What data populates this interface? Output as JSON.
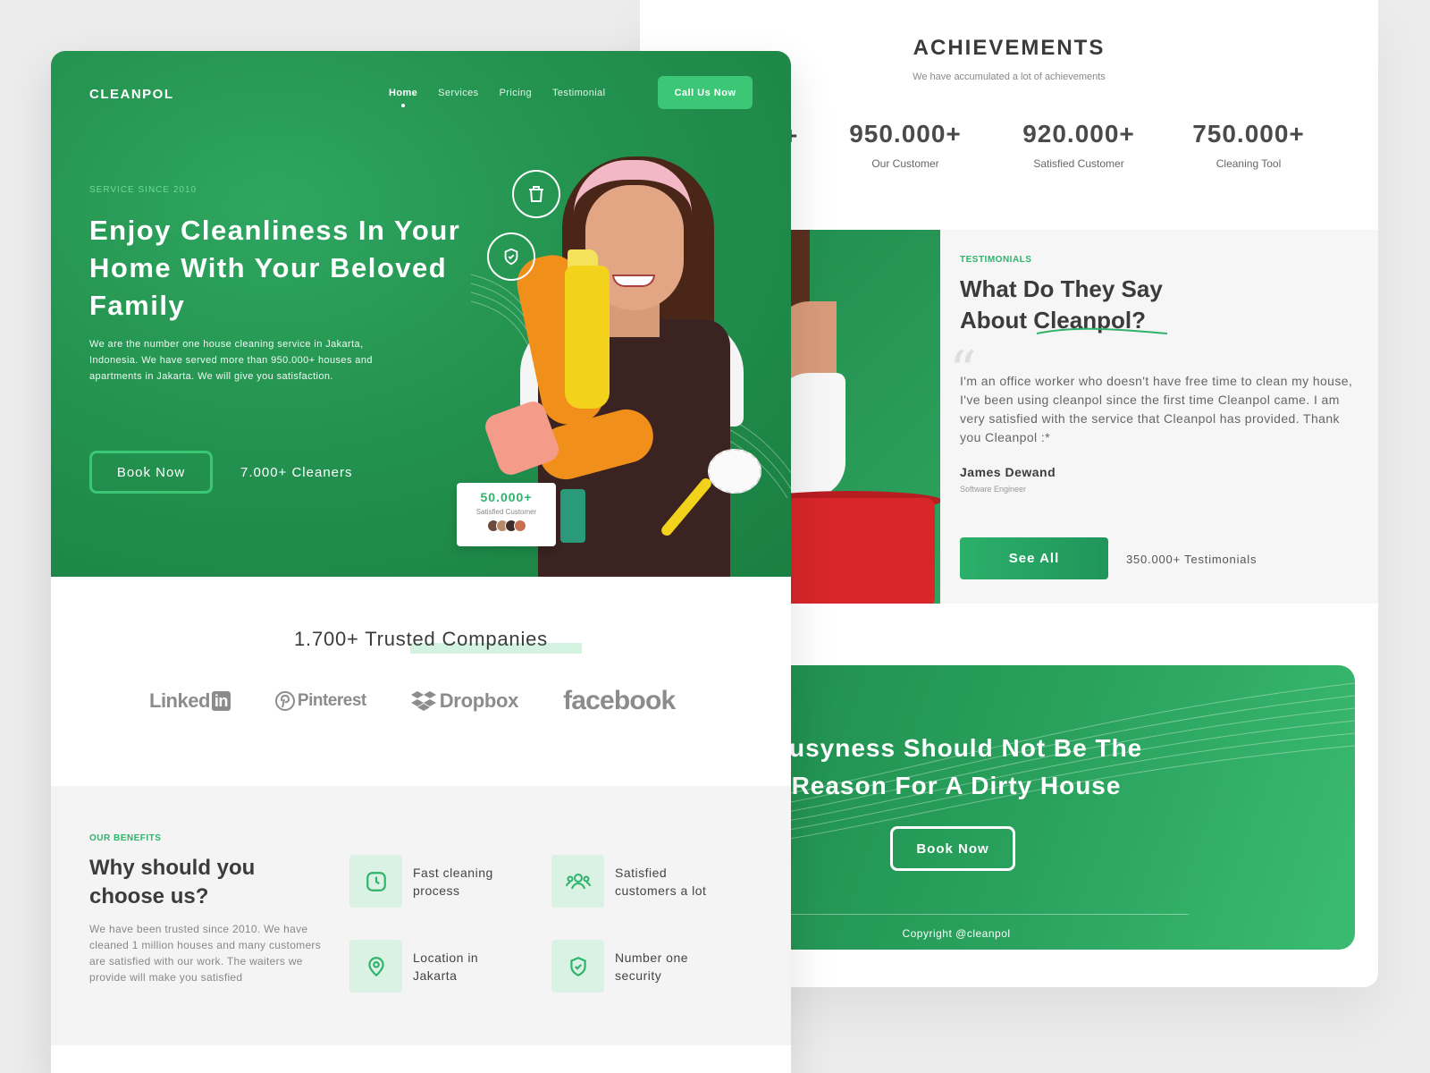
{
  "achievements": {
    "title": "ACHIEVEMENTS",
    "subtitle": "We have accumulated a lot of achievements",
    "stats": [
      {
        "value": "950.000+",
        "label": "Our Customer"
      },
      {
        "value": "920.000+",
        "label": "Satisfied Customer"
      },
      {
        "value": "750.000+",
        "label": "Cleaning Tool"
      }
    ]
  },
  "testimonials": {
    "eyebrow": "TESTIMONIALS",
    "heading_line1": "What Do They Say",
    "heading_line2": "About Cleanpol?",
    "quote": "I'm an office worker who doesn't have free time to clean my house, I've been using cleanpol since the first time Cleanpol came. I am very satisfied with the service that Cleanpol has provided. Thank you Cleanpol :*",
    "author": "James Dewand",
    "role": "Software Engineer",
    "see_all_label": "See All",
    "count": "350.000+ Testimonials"
  },
  "cta": {
    "heading_line1": "Busyness Should Not Be The",
    "heading_line2": "Reason For A Dirty House",
    "button_label": "Book Now",
    "copyright": "Copyright @cleanpol"
  },
  "header": {
    "logo": "CLEANPOL",
    "nav": [
      "Home",
      "Services",
      "Pricing",
      "Testimonial"
    ],
    "active_nav": "Home",
    "call_label": "Call Us Now"
  },
  "hero": {
    "eyebrow": "SERVICE SINCE 2010",
    "heading": "Enjoy Cleanliness In Your Home With Your Beloved Family",
    "description": "We are the number one house cleaning service in Jakarta, Indonesia. We have served more than 950.000+ houses and apartments in Jakarta. We will give you satisfaction.",
    "book_label": "Book Now",
    "cleaners": "7.000+ Cleaners",
    "badge_value": "50.000+",
    "badge_label": "Satisfied Customer",
    "icons": [
      "trash-icon",
      "shield-check-icon"
    ]
  },
  "trusted": {
    "heading": "1.700+ Trusted Companies",
    "brands": [
      "Linked",
      "in",
      "Pinterest",
      "Dropbox",
      "facebook"
    ]
  },
  "benefits": {
    "eyebrow": "OUR BENEFITS",
    "heading": "Why should you choose us?",
    "description": "We have been trusted since 2010. We have cleaned 1 million houses and many customers are satisfied with our work. The waiters we provide will make you satisfied",
    "items": [
      {
        "icon": "clock-icon",
        "label": "Fast cleaning process"
      },
      {
        "icon": "users-icon",
        "label": "Satisfied customers a lot"
      },
      {
        "icon": "location-pin-icon",
        "label": "Location in Jakarta"
      },
      {
        "icon": "shield-check-icon",
        "label": "Number one security"
      }
    ]
  },
  "colors": {
    "accent": "#2fb36a",
    "hero_green": "#23924f",
    "light_green": "#daf2e4"
  }
}
